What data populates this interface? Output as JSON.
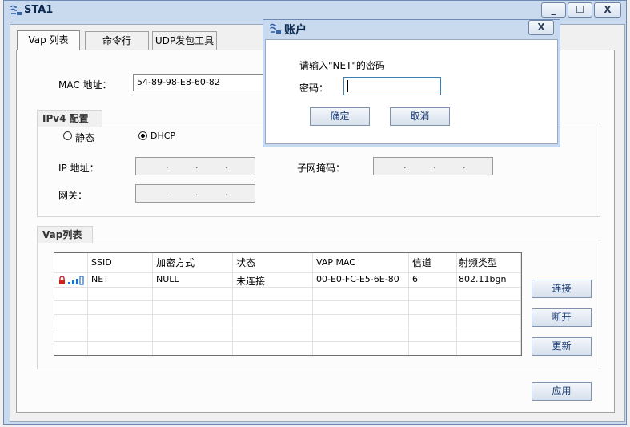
{
  "main_window": {
    "title": "STA1",
    "minimize": "_",
    "maximize": "☐",
    "close": "X"
  },
  "tabs": [
    {
      "label": "Vap 列表"
    },
    {
      "label": "命令行"
    },
    {
      "label": "UDP发包工具"
    }
  ],
  "mac": {
    "label": "MAC 地址：",
    "value": "54-89-98-E8-60-82"
  },
  "ipv4": {
    "group_title": "IPv4 配置",
    "static_label": "静态",
    "dhcp_label": "DHCP",
    "ip_label": "IP 地址：",
    "mask_label": "子网掩码：",
    "gateway_label": "网关："
  },
  "vap_group": {
    "title": "Vap列表",
    "columns": [
      "SSID",
      "加密方式",
      "状态",
      "VAP MAC",
      "信道",
      "射频类型"
    ],
    "rows": [
      {
        "ssid": "NET",
        "encryption": "NULL",
        "status": "未连接",
        "vap_mac": "00-E0-FC-E5-6E-80",
        "channel": "6",
        "radio": "802.11bgn"
      }
    ],
    "connect_button": "连接",
    "disconnect_button": "断开",
    "refresh_button": "更新"
  },
  "apply_button": "应用",
  "dialog": {
    "title": "账户",
    "close": "X",
    "prompt": "请输入\"NET\"的密码",
    "password_label": "密码：",
    "password_value": "",
    "ok_button": "确定",
    "cancel_button": "取消"
  },
  "colors": {
    "lock_icon": "#d02020",
    "signal_bars": "#1a6fd8",
    "button_text": "#1b3f78"
  }
}
